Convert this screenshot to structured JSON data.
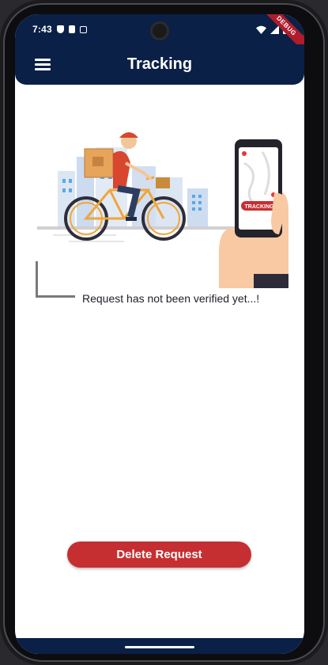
{
  "status_bar": {
    "time": "7:43",
    "left_icons": [
      "shield-icon",
      "sim-card-icon",
      "a-icon"
    ],
    "right_icons": [
      "wifi-icon",
      "signal-icon",
      "battery-icon"
    ],
    "debug_label": "DEBUG"
  },
  "app_bar": {
    "title": "Tracking",
    "menu_icon": "hamburger-menu-icon",
    "background_color": "#0b2047"
  },
  "illustration": {
    "phone_badge_text": "TRACKING"
  },
  "main": {
    "status_message": "Request has not been verified yet...!"
  },
  "actions": {
    "delete_label": "Delete Request",
    "delete_color": "#c62f31"
  }
}
